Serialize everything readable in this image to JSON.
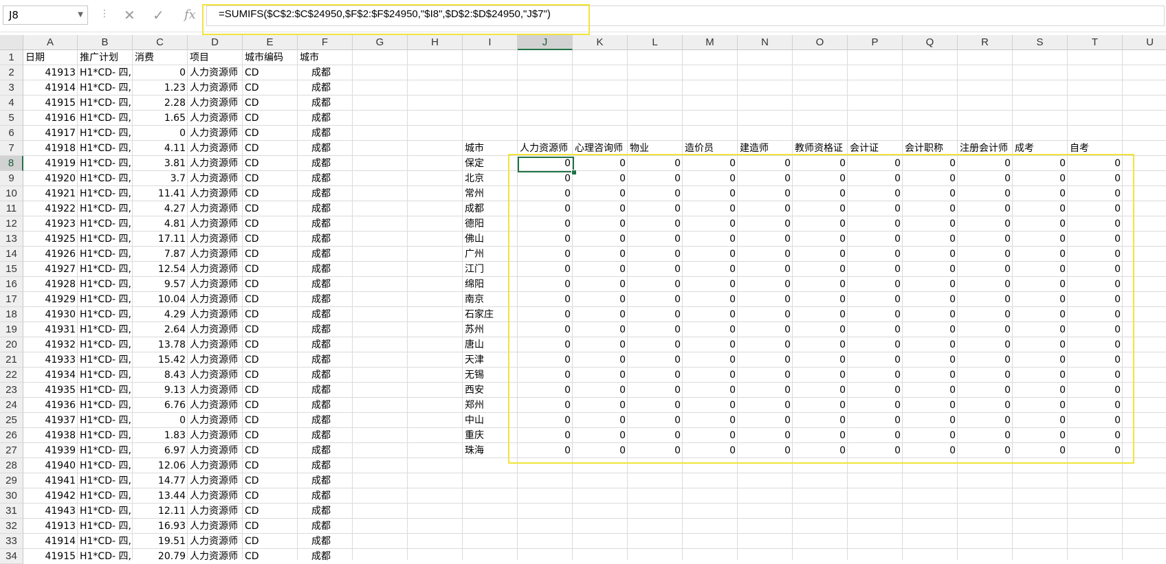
{
  "name_box": "J8",
  "formula": "=SUMIFS($C$2:$C$24950,$F$2:$F$24950,\"$I8\",$D$2:$D$24950,\"J$7\")",
  "icons": {
    "cancel": "close-icon",
    "confirm": "check-icon",
    "function": "fx-icon",
    "dropdown": "chevron-down-icon"
  },
  "fx_label": "fx",
  "colors": {
    "highlight": "#f2e43a",
    "selection": "#217346"
  },
  "columns": [
    "A",
    "B",
    "C",
    "D",
    "E",
    "F",
    "G",
    "H",
    "I",
    "J",
    "K",
    "L",
    "M",
    "N",
    "O",
    "P",
    "Q",
    "R",
    "S",
    "T",
    "U"
  ],
  "selected_column": "J",
  "rows": [
    "1",
    "2",
    "3",
    "4",
    "5",
    "6",
    "7",
    "8",
    "9",
    "10",
    "11",
    "12",
    "13",
    "14",
    "15",
    "16",
    "17",
    "18",
    "19",
    "20",
    "21",
    "22",
    "23",
    "24",
    "25",
    "26",
    "27",
    "28",
    "29",
    "30",
    "31",
    "32",
    "33",
    "34"
  ],
  "selected_row": "8",
  "data_headers": [
    "日期",
    "推广计划",
    "消费",
    "项目",
    "城市编码",
    "城市"
  ],
  "data_rows": [
    [
      "41913",
      "H1*CD- 四,",
      "0",
      "人力资源师",
      "CD",
      "成都"
    ],
    [
      "41914",
      "H1*CD- 四,",
      "1.23",
      "人力资源师",
      "CD",
      "成都"
    ],
    [
      "41915",
      "H1*CD- 四,",
      "2.28",
      "人力资源师",
      "CD",
      "成都"
    ],
    [
      "41916",
      "H1*CD- 四,",
      "1.65",
      "人力资源师",
      "CD",
      "成都"
    ],
    [
      "41917",
      "H1*CD- 四,",
      "0",
      "人力资源师",
      "CD",
      "成都"
    ],
    [
      "41918",
      "H1*CD- 四,",
      "4.11",
      "人力资源师",
      "CD",
      "成都"
    ],
    [
      "41919",
      "H1*CD- 四,",
      "3.81",
      "人力资源师",
      "CD",
      "成都"
    ],
    [
      "41920",
      "H1*CD- 四,",
      "3.7",
      "人力资源师",
      "CD",
      "成都"
    ],
    [
      "41921",
      "H1*CD- 四,",
      "11.41",
      "人力资源师",
      "CD",
      "成都"
    ],
    [
      "41922",
      "H1*CD- 四,",
      "4.27",
      "人力资源师",
      "CD",
      "成都"
    ],
    [
      "41923",
      "H1*CD- 四,",
      "4.81",
      "人力资源师",
      "CD",
      "成都"
    ],
    [
      "41925",
      "H1*CD- 四,",
      "17.11",
      "人力资源师",
      "CD",
      "成都"
    ],
    [
      "41926",
      "H1*CD- 四,",
      "7.87",
      "人力资源师",
      "CD",
      "成都"
    ],
    [
      "41927",
      "H1*CD- 四,",
      "12.54",
      "人力资源师",
      "CD",
      "成都"
    ],
    [
      "41928",
      "H1*CD- 四,",
      "9.57",
      "人力资源师",
      "CD",
      "成都"
    ],
    [
      "41929",
      "H1*CD- 四,",
      "10.04",
      "人力资源师",
      "CD",
      "成都"
    ],
    [
      "41930",
      "H1*CD- 四,",
      "4.29",
      "人力资源师",
      "CD",
      "成都"
    ],
    [
      "41931",
      "H1*CD- 四,",
      "2.64",
      "人力资源师",
      "CD",
      "成都"
    ],
    [
      "41932",
      "H1*CD- 四,",
      "13.78",
      "人力资源师",
      "CD",
      "成都"
    ],
    [
      "41933",
      "H1*CD- 四,",
      "15.42",
      "人力资源师",
      "CD",
      "成都"
    ],
    [
      "41934",
      "H1*CD- 四,",
      "8.43",
      "人力资源师",
      "CD",
      "成都"
    ],
    [
      "41935",
      "H1*CD- 四,",
      "9.13",
      "人力资源师",
      "CD",
      "成都"
    ],
    [
      "41936",
      "H1*CD- 四,",
      "6.76",
      "人力资源师",
      "CD",
      "成都"
    ],
    [
      "41937",
      "H1*CD- 四,",
      "0",
      "人力资源师",
      "CD",
      "成都"
    ],
    [
      "41938",
      "H1*CD- 四,",
      "1.83",
      "人力资源师",
      "CD",
      "成都"
    ],
    [
      "41939",
      "H1*CD- 四,",
      "6.97",
      "人力资源师",
      "CD",
      "成都"
    ],
    [
      "41940",
      "H1*CD- 四,",
      "12.06",
      "人力资源师",
      "CD",
      "成都"
    ],
    [
      "41941",
      "H1*CD- 四,",
      "14.77",
      "人力资源师",
      "CD",
      "成都"
    ],
    [
      "41942",
      "H1*CD- 四,",
      "13.44",
      "人力资源师",
      "CD",
      "成都"
    ],
    [
      "41943",
      "H1*CD- 四,",
      "12.11",
      "人力资源师",
      "CD",
      "成都"
    ],
    [
      "41913",
      "H1*CD- 四,",
      "16.93",
      "人力资源师",
      "CD",
      "成都"
    ],
    [
      "41914",
      "H1*CD- 四,",
      "19.51",
      "人力资源师",
      "CD",
      "成都"
    ],
    [
      "41915",
      "H1*CD- 四,",
      "20.79",
      "人力资源师",
      "CD",
      "成都"
    ]
  ],
  "summary_corner": "城市",
  "summary_headers": [
    "人力资源师",
    "心理咨询师",
    "物业",
    "造价员",
    "建造师",
    "教师资格证",
    "会计证",
    "会计职称",
    "注册会计师",
    "成考",
    "自考"
  ],
  "summary_cities": [
    "保定",
    "北京",
    "常州",
    "成都",
    "德阳",
    "佛山",
    "广州",
    "江门",
    "绵阳",
    "南京",
    "石家庄",
    "苏州",
    "唐山",
    "天津",
    "无锡",
    "西安",
    "郑州",
    "中山",
    "重庆",
    "珠海"
  ],
  "summary_value": "0"
}
